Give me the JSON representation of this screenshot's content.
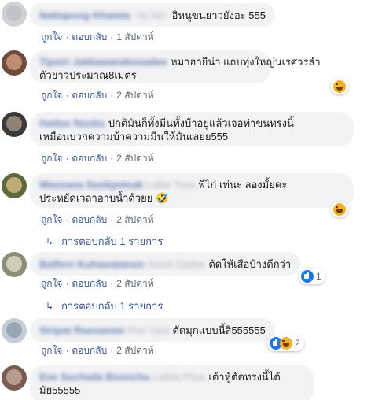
{
  "actions": {
    "like": "ถูกใจ",
    "reply": "ตอบกลับ",
    "sep": "·"
  },
  "reply_link": {
    "label": "การตอบกลับ 1 รายการ",
    "arrow": "↳"
  },
  "comments": [
    {
      "name": "Nattapong Khamta",
      "tag": "Ya Nin",
      "text": "อิหนูขนยาวยังอะ 555",
      "time": "1 สัปดาห์",
      "avatar_colors": [
        "#cfd2d6",
        "#b9bdc3"
      ]
    },
    {
      "name": "Tipsiri Jakkawandeesadee",
      "tag": "",
      "text_lines": [
        "หมาฮายีน่า แถบทุ่งใหญ่นเรศวรลำ",
        "ตัวยาวประมาณ8เมตร"
      ],
      "time": "2 สัปดาห์",
      "reactions": {
        "icons": [
          "haha"
        ]
      },
      "avatar_colors": [
        "#6e4b3a",
        "#d9a58a"
      ]
    },
    {
      "name": "Hattee Noobs",
      "tag": "",
      "text_lines": [
        "ปกติมันก็ทั้งมีนทั้งบ้าอยู่แล้วเจอท่าขนทรงนี้",
        "เหมือนบวกความบ้าความมีนให้มันเลยย555"
      ],
      "time": "2 สัปดาห์",
      "avatar_colors": [
        "#3c3a36",
        "#a89b8c"
      ]
    },
    {
      "name": "Wassana Sookpetsak",
      "tag": "Lalita Tosa",
      "text_lines": [
        "พี่ไก่ เท่นะ ลองมั้ยคะ",
        "ประหยัดเวลาอาบน้ำด้วยย 🤣"
      ],
      "time": "2 สัปดาห์",
      "reactions": {
        "icons": [
          "haha"
        ]
      },
      "avatar_colors": [
        "#5a6a3a",
        "#e0c08a"
      ]
    },
    {
      "name": "Baifern Kuhawatanon",
      "tag": "Good Dadee",
      "text": "ตัดให้เสือบ้างดีกว่า",
      "time": "2 สัปดาห์",
      "reactions": {
        "icons": [
          "like"
        ],
        "count": "1"
      },
      "avatar_colors": [
        "#8a8f7a",
        "#e6e2cf"
      ]
    },
    {
      "name": "Siripat Rassamee",
      "tag": "Pee Yard",
      "text": "ตัดมุกแบบนี้สิ555555",
      "time": "2 สัปดาห์",
      "reactions": {
        "icons": [
          "like",
          "haha"
        ],
        "count": "2"
      },
      "avatar_colors": [
        "#c7cdd6",
        "#8b98aa"
      ]
    },
    {
      "name": "Eve Suchada Boonchu",
      "tag": "Lalida Pisai",
      "text_lines": [
        "เต้าหู้ตัดทรงนี้ได้",
        "มัย55555"
      ],
      "avatar_colors": [
        "#7a5c4e",
        "#c9b2a6"
      ]
    }
  ]
}
